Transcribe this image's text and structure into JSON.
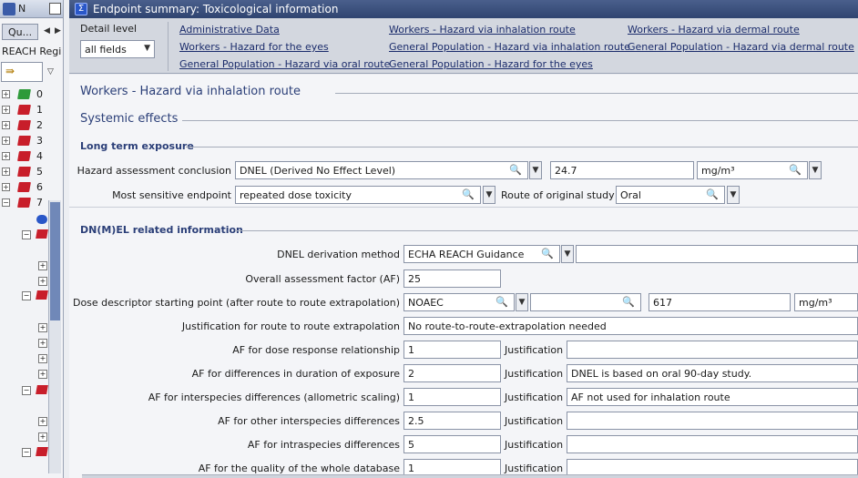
{
  "left_pane": {
    "title": "N",
    "tab_label": "Qu...",
    "reach_label": "REACH Regi:",
    "tree_numbers": [
      "0",
      "1",
      "2",
      "3",
      "4",
      "5",
      "6",
      "7"
    ]
  },
  "window": {
    "title": "Endpoint summary: Toxicological information"
  },
  "toolbar": {
    "detail_level_label": "Detail level",
    "detail_level_value": "all fields",
    "links": [
      "Administrative Data",
      "Workers - Hazard via inhalation route",
      "Workers - Hazard via dermal route",
      "Workers - Hazard for the eyes",
      "General Population - Hazard via inhalation route",
      "General Population - Hazard via dermal route",
      "General Population - Hazard via oral route",
      "General Population - Hazard for the eyes"
    ]
  },
  "content": {
    "section_title": "Workers - Hazard via inhalation route",
    "systemic_title": "Systemic effects",
    "long_term_title": "Long term exposure",
    "hazard_label": "Hazard assessment conclusion",
    "hazard_value": "DNEL (Derived No Effect Level)",
    "hazard_number": "24.7",
    "hazard_unit": "mg/m³",
    "sensitive_label": "Most sensitive endpoint",
    "sensitive_value": "repeated dose toxicity",
    "route_label": "Route of original study",
    "route_value": "Oral",
    "dnel_info_title": "DN(M)EL related information",
    "derivation_label": "DNEL derivation method",
    "derivation_value": "ECHA REACH Guidance",
    "overall_af_label": "Overall assessment factor (AF)",
    "overall_af_value": "25",
    "dose_label": "Dose descriptor starting point (after route to route extrapolation)",
    "dose_value": "NOAEC",
    "dose_number": "617",
    "dose_unit": "mg/m³",
    "justif_route_label": "Justification for route to route extrapolation",
    "justif_route_value": "No route-to-route-extrapolation needed",
    "justification_label": "Justification",
    "af_rows": [
      {
        "label": "AF for dose response relationship",
        "value": "1",
        "justification": ""
      },
      {
        "label": "AF for differences in duration of exposure",
        "value": "2",
        "justification": "DNEL is based on oral 90-day study."
      },
      {
        "label": "AF for interspecies differences (allometric scaling)",
        "value": "1",
        "justification": "AF not used for inhalation route"
      },
      {
        "label": "AF for other interspecies differences",
        "value": "2.5",
        "justification": ""
      },
      {
        "label": "AF for intraspecies differences",
        "value": "5",
        "justification": ""
      },
      {
        "label": "AF for the quality of the whole database",
        "value": "1",
        "justification": ""
      }
    ]
  }
}
